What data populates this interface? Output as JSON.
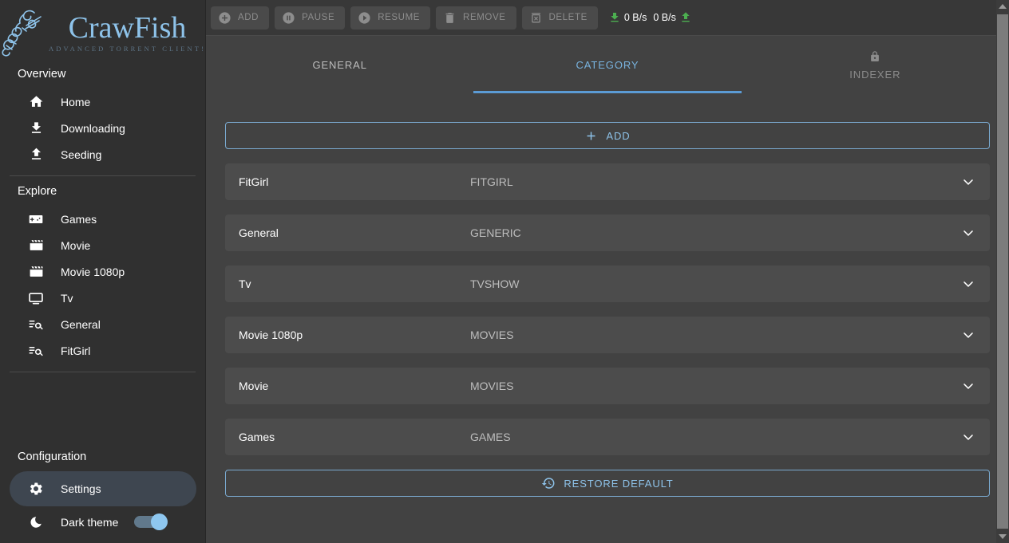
{
  "brand": {
    "name": "CrawFish",
    "tagline": "ADVANCED TORRENT CLIENT!",
    "logo_icon": "crawfish-logo-icon",
    "accent_color": "#8ec3ea"
  },
  "sidebar": {
    "sections": [
      {
        "title": "Overview",
        "items": [
          {
            "label": "Home",
            "icon": "home-icon"
          },
          {
            "label": "Downloading",
            "icon": "download-icon"
          },
          {
            "label": "Seeding",
            "icon": "upload-icon"
          }
        ]
      },
      {
        "title": "Explore",
        "items": [
          {
            "label": "Games",
            "icon": "gamepad-icon"
          },
          {
            "label": "Movie",
            "icon": "movie-clapper-icon"
          },
          {
            "label": "Movie 1080p",
            "icon": "movie-clapper-icon"
          },
          {
            "label": "Tv",
            "icon": "tv-monitor-icon"
          },
          {
            "label": "General",
            "icon": "manage-search-icon"
          },
          {
            "label": "FitGirl",
            "icon": "manage-search-icon"
          }
        ]
      }
    ],
    "configuration": {
      "title": "Configuration",
      "settings": {
        "label": "Settings",
        "icon": "gear-icon",
        "active": true
      },
      "theme": {
        "label": "Dark theme",
        "icon": "moon-icon",
        "enabled": true
      }
    }
  },
  "toolbar": {
    "buttons": [
      {
        "label": "ADD",
        "icon": "plus-circle-icon",
        "disabled": true
      },
      {
        "label": "PAUSE",
        "icon": "pause-circle-icon",
        "disabled": true
      },
      {
        "label": "RESUME",
        "icon": "play-circle-icon",
        "disabled": true
      },
      {
        "label": "REMOVE",
        "icon": "trash-icon",
        "disabled": true
      },
      {
        "label": "DELETE",
        "icon": "delete-forever-icon",
        "disabled": true
      }
    ],
    "speed": {
      "download_icon": "download-arrow-icon",
      "download_value": "0 B/s",
      "upload_value": "0 B/s",
      "upload_icon": "upload-arrow-icon",
      "color": "#4caf50"
    }
  },
  "tabs": [
    {
      "label": "GENERAL",
      "active": false,
      "disabled": false,
      "icon": null
    },
    {
      "label": "CATEGORY",
      "active": true,
      "disabled": false,
      "icon": null
    },
    {
      "label": "INDEXER",
      "active": false,
      "disabled": true,
      "icon": "lock-icon"
    }
  ],
  "main": {
    "add_button": {
      "label": "ADD",
      "icon": "plus-icon"
    },
    "restore_button": {
      "label": "RESTORE DEFAULT",
      "icon": "restore-icon"
    },
    "categories": [
      {
        "name": "FitGirl",
        "type": "FITGIRL",
        "expand_icon": "chevron-down-icon"
      },
      {
        "name": "General",
        "type": "GENERIC",
        "expand_icon": "chevron-down-icon"
      },
      {
        "name": "Tv",
        "type": "TVSHOW",
        "expand_icon": "chevron-down-icon"
      },
      {
        "name": "Movie 1080p",
        "type": "MOVIES",
        "expand_icon": "chevron-down-icon"
      },
      {
        "name": "Movie",
        "type": "MOVIES",
        "expand_icon": "chevron-down-icon"
      },
      {
        "name": "Games",
        "type": "GAMES",
        "expand_icon": "chevron-down-icon"
      }
    ]
  },
  "scrollbar": {
    "up_icon": "scroll-up-arrow-icon",
    "down_icon": "scroll-down-arrow-icon"
  }
}
